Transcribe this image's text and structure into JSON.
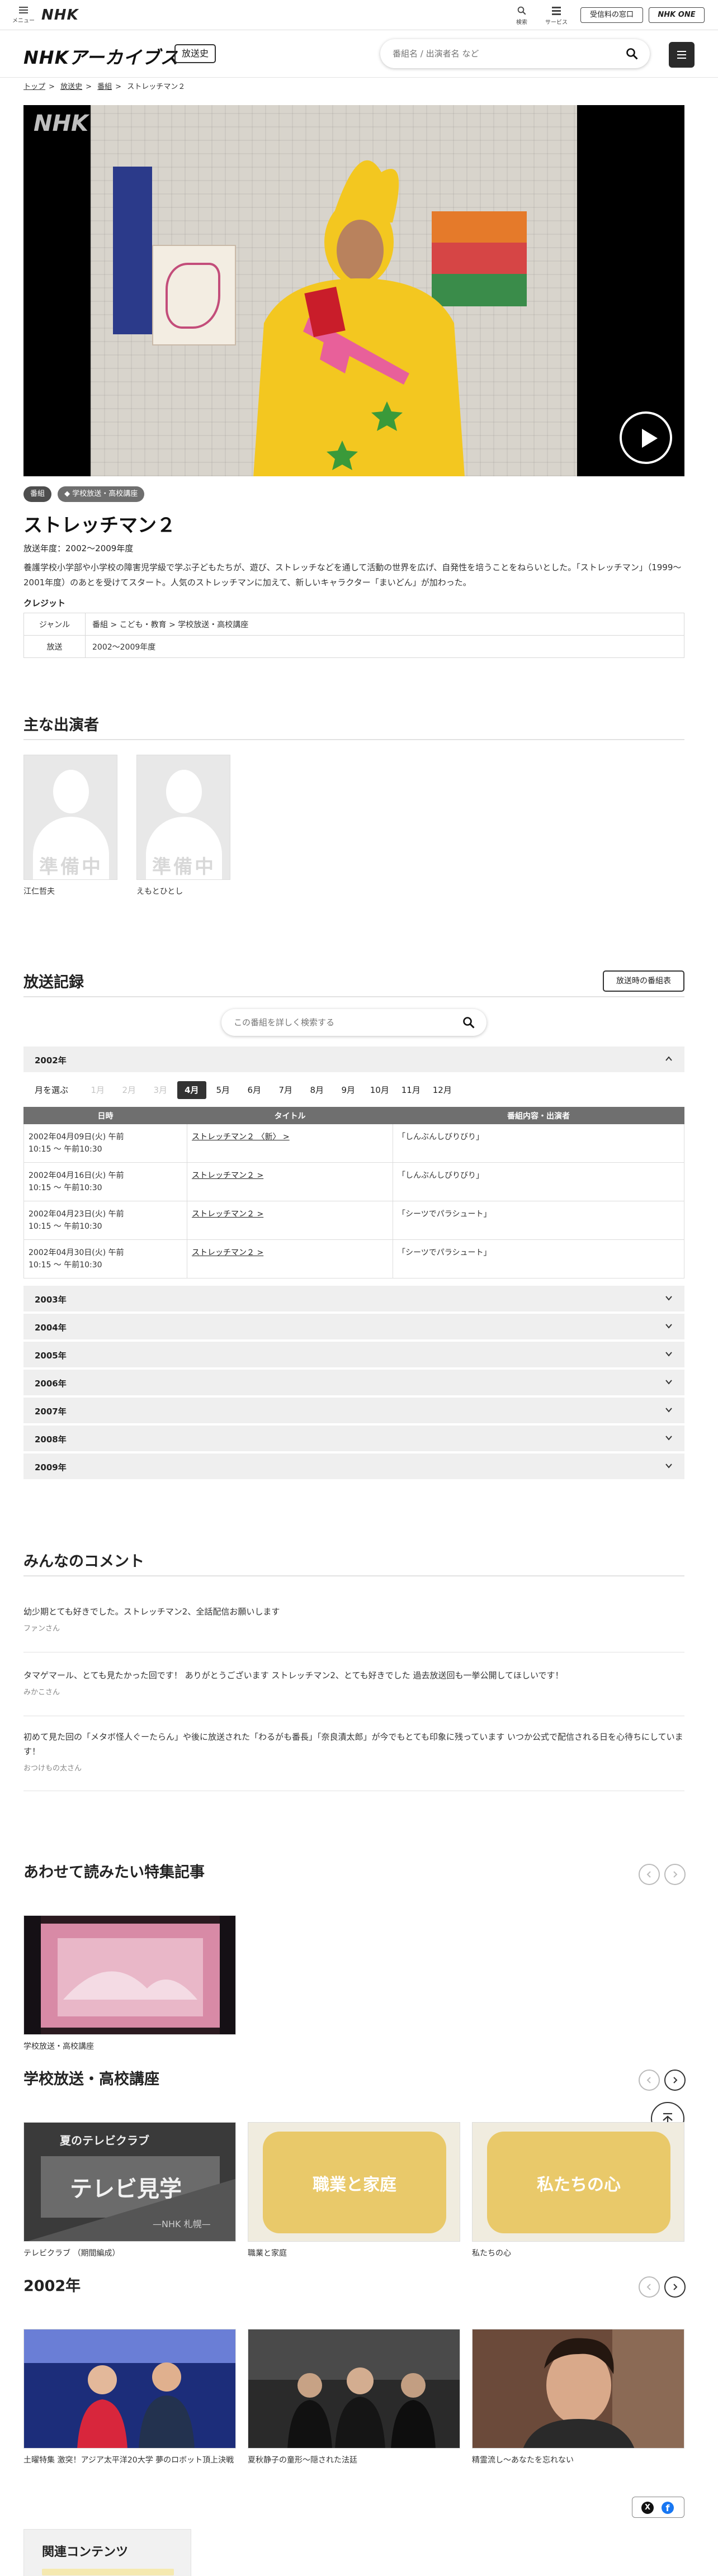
{
  "global_nav": {
    "menu_label": "メニュー",
    "logo": "NHK",
    "search_label": "検索",
    "service_label": "サービス",
    "reception_label": "受信料の窓口",
    "one_label": "NHK ONE"
  },
  "header": {
    "logo": "NHKアーカイブス",
    "section_badge": "放送史",
    "search_placeholder": "番組名 / 出演者名 など"
  },
  "breadcrumb": [
    "トップ",
    "放送史",
    "番組",
    "ストレッチマン２"
  ],
  "video": {
    "watermark": "NHK"
  },
  "program": {
    "tags": [
      "番組",
      "学校放送・高校講座"
    ],
    "title": "ストレッチマン２",
    "air_year": "放送年度：2002〜2009年度",
    "description": "養護学校小学部や小学校の障害児学級で学ぶ子どもたちが、遊び、ストレッチなどを通して活動の世界を広げ、自発性を培うことをねらいとした。「ストレッチマン」（1999〜2001年度）のあとを受けてスタート。人気のストレッチマンに加えて、新しいキャラクター「まいどん」が加わった。",
    "credit_label": "クレジット",
    "info": [
      {
        "key": "ジャンル",
        "value": "番組 > こども・教育 > 学校放送・高校講座"
      },
      {
        "key": "放送",
        "value": "2002〜2009年度"
      }
    ]
  },
  "cast": {
    "heading": "主な出演者",
    "placeholder": "準備中",
    "members": [
      "江仁哲夫",
      "えもとひとし"
    ]
  },
  "records": {
    "heading": "放送記録",
    "at_broadcast_button": "放送時の番組表",
    "search_placeholder": "この番組を詳しく検索する",
    "open_year": "2002年",
    "month_label": "月を選ぶ",
    "months": [
      {
        "label": "1月",
        "state": "disabled"
      },
      {
        "label": "2月",
        "state": "disabled"
      },
      {
        "label": "3月",
        "state": "disabled"
      },
      {
        "label": "4月",
        "state": "active"
      },
      {
        "label": "5月",
        "state": "normal"
      },
      {
        "label": "6月",
        "state": "normal"
      },
      {
        "label": "7月",
        "state": "normal"
      },
      {
        "label": "8月",
        "state": "normal"
      },
      {
        "label": "9月",
        "state": "normal"
      },
      {
        "label": "10月",
        "state": "normal"
      },
      {
        "label": "11月",
        "state": "normal"
      },
      {
        "label": "12月",
        "state": "normal"
      }
    ],
    "columns": [
      "日時",
      "タイトル",
      "番組内容・出演者"
    ],
    "rows": [
      {
        "date": "2002年04月09日(火) 午前",
        "time": "10:15 ～ 午前10:30",
        "title": "ストレッチマン２ 〈新〉 >",
        "content": "「しんぶんしびりびり」"
      },
      {
        "date": "2002年04月16日(火) 午前",
        "time": "10:15 ～ 午前10:30",
        "title": "ストレッチマン２ >",
        "content": "「しんぶんしびりびり」"
      },
      {
        "date": "2002年04月23日(火) 午前",
        "time": "10:15 ～ 午前10:30",
        "title": "ストレッチマン２ >",
        "content": "「シーツでパラシュート」"
      },
      {
        "date": "2002年04月30日(火) 午前",
        "time": "10:15 ～ 午前10:30",
        "title": "ストレッチマン２ >",
        "content": "「シーツでパラシュート」"
      }
    ],
    "collapsed_years": [
      "2003年",
      "2004年",
      "2005年",
      "2006年",
      "2007年",
      "2008年",
      "2009年"
    ]
  },
  "comments": {
    "heading": "みんなのコメント",
    "items": [
      {
        "text": "幼少期とても好きでした。ストレッチマン2、全話配信お願いします",
        "author": "ファンさん"
      },
      {
        "text": "タマゲマール、とても見たかった回です！ ありがとうございます ストレッチマン2、とても好きでした 過去放送回も一挙公開してほしいです！",
        "author": "みかこさん"
      },
      {
        "text": "初めて見た回の「メタボ怪人ぐーたらん」や後に放送された「わるがも番長」「奈良漬太郎」が今でもとても印象に残っています いつか公式で配信される日を心待ちにしています！",
        "author": "おつけもの太さん"
      }
    ]
  },
  "features": {
    "heading": "あわせて読みたい特集記事",
    "items": [
      {
        "caption": "学校放送・高校講座"
      }
    ]
  },
  "school": {
    "heading": "学校放送・高校講座",
    "items": [
      {
        "caption": "テレビクラブ （期間編成）",
        "overlay": "夏のテレビクラブ",
        "big": "テレビ見学",
        "small": "—NHK 札幌—"
      },
      {
        "caption": "職業と家庭",
        "big": "職業と家庭"
      },
      {
        "caption": "私たちの心",
        "big": "私たちの心"
      }
    ]
  },
  "year2002": {
    "heading": "2002年",
    "items": [
      {
        "caption": "土曜特集 激突！アジア太平洋20大学 夢のロボット頂上決戦"
      },
      {
        "caption": "夏秋静子の童形～隠された法廷"
      },
      {
        "caption": "精霊流し～あなたを忘れない"
      }
    ]
  },
  "share": {
    "x": "X",
    "facebook": "f"
  },
  "related": {
    "heading": "関連コンテンツ"
  }
}
